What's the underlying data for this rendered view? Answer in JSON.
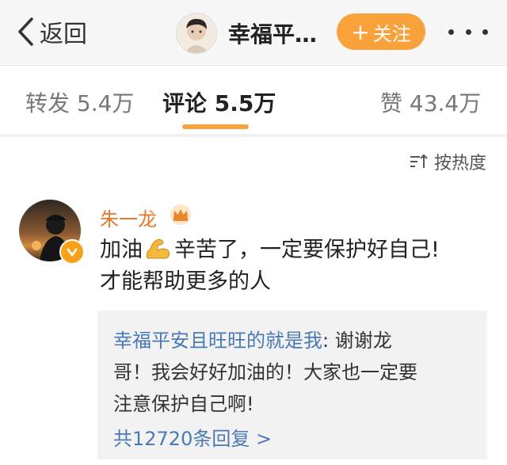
{
  "navbar": {
    "back_label": "返回",
    "title": "幸福平…",
    "follow_label": "关注",
    "follow_plus": "+"
  },
  "tabs": {
    "repost": "转发 5.4万",
    "comment": "评论 5.5万",
    "like": "赞 43.4万"
  },
  "sort": {
    "label": "按热度"
  },
  "comment": {
    "author": "朱一龙",
    "text_part1": "加油",
    "text_part2": "辛苦了，一定要保护好自己!",
    "text_line2": "才能帮助更多的人",
    "reply": {
      "user": "幸福平安且旺旺的就是我",
      "line1_rest": ": 谢谢龙",
      "line2": "哥！我会好好加油的！大家也一定要",
      "line3": "注意保护自己啊!",
      "count_label": "共12720条回复 >"
    }
  },
  "colors": {
    "accent": "#f9a23b",
    "link": "#4a7ab5",
    "name": "#e8772b"
  }
}
